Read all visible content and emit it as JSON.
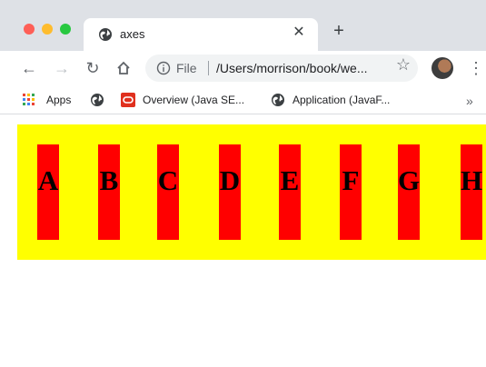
{
  "tab": {
    "title": "axes"
  },
  "toolbar": {
    "file_label": "File",
    "url": "/Users/morrison/book/we..."
  },
  "bookmarks": {
    "apps": "Apps",
    "overview": "Overview (Java SE...",
    "application": "Application (JavaF...",
    "more": "»"
  },
  "page": {
    "letters": [
      "A",
      "B",
      "C",
      "D",
      "E",
      "F",
      "G",
      "H"
    ],
    "colors": {
      "band": "#ffff00",
      "cell": "#ff0000",
      "text": "#000000"
    }
  },
  "icons": {
    "globe": "globe-icon",
    "info": "info-icon",
    "star": "star-icon",
    "apps": "apps-grid-icon",
    "oracle": "oracle-icon"
  }
}
